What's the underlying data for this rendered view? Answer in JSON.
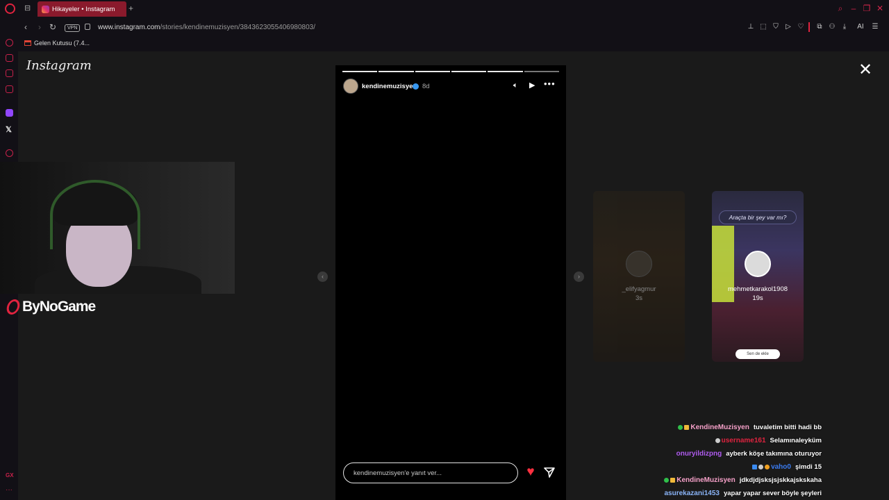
{
  "browser": {
    "tab_title": "Hikayeler • Instagram",
    "url_host": "www.instagram.com",
    "url_path": "/stories/kendinemuzisyen/3843623055406980803/",
    "vpn_label": "VPN",
    "bookmark_gmail": "Gelen Kutusu (7.4...",
    "toolbar_ai": "AI"
  },
  "instagram": {
    "logo": "Instagram",
    "story": {
      "username": "kendinemuzisyen",
      "time": "8d",
      "segments_total": 6,
      "segments_done": 5,
      "reply_placeholder": "kendinemuzisyen'e yanıt ver..."
    },
    "next_stories": [
      {
        "username": "_elifyagmur",
        "time": "3s"
      },
      {
        "username": "mehmetkarakol1908",
        "time": "19s",
        "headline": "Araçta bir şey var mı?",
        "sticker": "Sen de ekle"
      }
    ]
  },
  "stream": {
    "brand": "ByNoGame"
  },
  "chat": [
    {
      "user": "KendineMuzisyen",
      "color": "#f5a0c8",
      "message": "tuvaletim bitti hadi bb"
    },
    {
      "user": "username161",
      "color": "#e0233f",
      "message": "Selamınaleyküm"
    },
    {
      "user": "onuryildizpng",
      "color": "#b05cf0",
      "message": "ayberk köşe takımına oturuyor"
    },
    {
      "user": "vaho0",
      "color": "#3a7bf0",
      "message": "şimdi 15"
    },
    {
      "user": "KendineMuzisyen",
      "color": "#f5a0c8",
      "message": "jdkdjdjsksjsjskkajskskaha"
    },
    {
      "user": "asurekazani1453",
      "color": "#8ab4f8",
      "message": "yapar yapar sever böyle şeyleri"
    }
  ]
}
